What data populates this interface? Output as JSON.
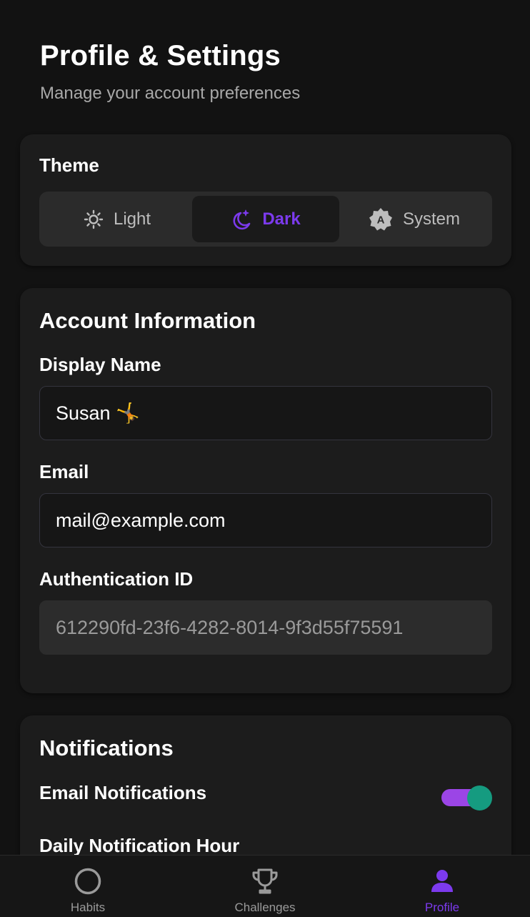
{
  "header": {
    "title": "Profile & Settings",
    "subtitle": "Manage your account preferences"
  },
  "theme": {
    "label": "Theme",
    "options": [
      {
        "label": "Light",
        "icon": "sun-icon",
        "selected": false
      },
      {
        "label": "Dark",
        "icon": "moon-stars-icon",
        "selected": true
      },
      {
        "label": "System",
        "icon": "auto-theme-icon",
        "selected": false
      }
    ]
  },
  "account": {
    "title": "Account Information",
    "display_name_label": "Display Name",
    "display_name_value": "Susan 🤸",
    "email_label": "Email",
    "email_value": "mail@example.com",
    "auth_id_label": "Authentication ID",
    "auth_id_value": "612290fd-23f6-4282-8014-9f3d55f75591"
  },
  "notifications": {
    "title": "Notifications",
    "email_label": "Email Notifications",
    "email_enabled": true,
    "daily_hour_label": "Daily Notification Hour"
  },
  "nav": {
    "items": [
      {
        "label": "Habits",
        "icon": "circle-icon",
        "active": false
      },
      {
        "label": "Challenges",
        "icon": "trophy-icon",
        "active": false
      },
      {
        "label": "Profile",
        "icon": "person-icon",
        "active": true
      }
    ]
  },
  "colors": {
    "background": "#121212",
    "card": "#1c1c1c",
    "accent": "#7c3aed",
    "toggle_track": "#9b45e6",
    "toggle_knob": "#159b80"
  }
}
